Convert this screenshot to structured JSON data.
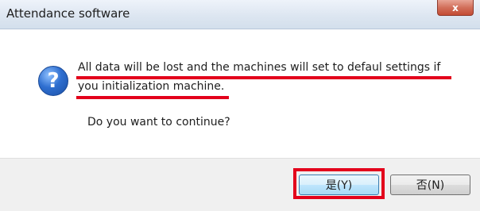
{
  "window": {
    "title": "Attendance software",
    "close_label": "x"
  },
  "message": {
    "line1": "All data will be lost and the machines will set to defaul settings if",
    "line2": "you initialization machine.",
    "question": "Do you want to continue?",
    "icon": "question-icon"
  },
  "buttons": {
    "yes_label": "是(Y)",
    "no_label": "否(N)"
  },
  "colors": {
    "highlight": "#e3001b",
    "icon_blue": "#2f6fd0"
  }
}
